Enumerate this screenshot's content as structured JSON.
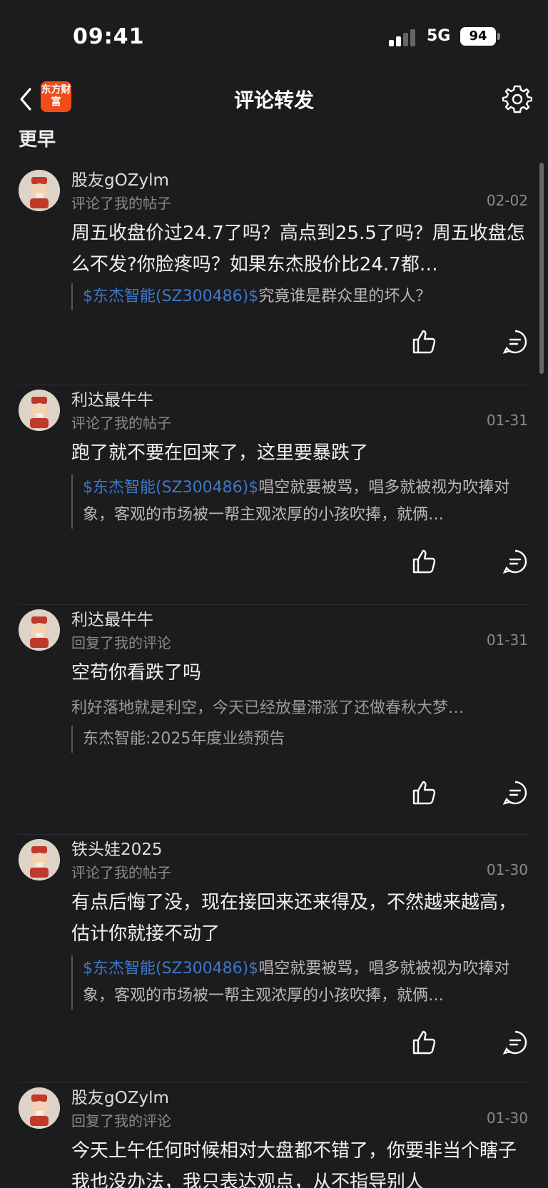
{
  "status_bar": {
    "time": "09:41",
    "network": "5G",
    "battery": "94"
  },
  "nav": {
    "title": "评论转发",
    "logo_text": "东方财富"
  },
  "section_title": "更早",
  "items": [
    {
      "username": "股友gOZylm",
      "action": "评论了我的帖子",
      "date": "02-02",
      "body": "周五收盘价过24.7了吗？高点到25.5了吗？周五收盘怎么不发?你脸疼吗？如果东杰股价比24.7都…",
      "quote_stock": "$东杰智能(SZ300486)$",
      "quote_text": "究竟谁是群众里的坏人？"
    },
    {
      "username": "利达最牛牛",
      "action": "评论了我的帖子",
      "date": "01-31",
      "body": "跑了就不要在回来了，这里要暴跌了",
      "quote_stock": "$东杰智能(SZ300486)$",
      "quote_text": "唱空就要被骂，唱多就被视为吹捧对象，客观的市场被一帮主观浓厚的小孩吹捧，就俩…"
    },
    {
      "username": "利达最牛牛",
      "action": "回复了我的评论",
      "date": "01-31",
      "body": "空苟你看跌了吗",
      "extra_text": "利好落地就是利空，今天已经放量滞涨了还做春秋大梦…",
      "quote_text": "东杰智能:2025年度业绩预告"
    },
    {
      "username": "铁头娃2025",
      "action": "评论了我的帖子",
      "date": "01-30",
      "body": "有点后悔了没，现在接回来还来得及，不然越来越高，估计你就接不动了",
      "quote_stock": "$东杰智能(SZ300486)$",
      "quote_text": "唱空就要被骂，唱多就被视为吹捧对象，客观的市场被一帮主观浓厚的小孩吹捧，就俩…"
    },
    {
      "username": "股友gOZylm",
      "action": "回复了我的评论",
      "date": "01-30",
      "body": "今天上午任何时候相对大盘都不错了，你要非当个瞎子我也没办法，我只表达观点，从不指导别人"
    }
  ]
}
